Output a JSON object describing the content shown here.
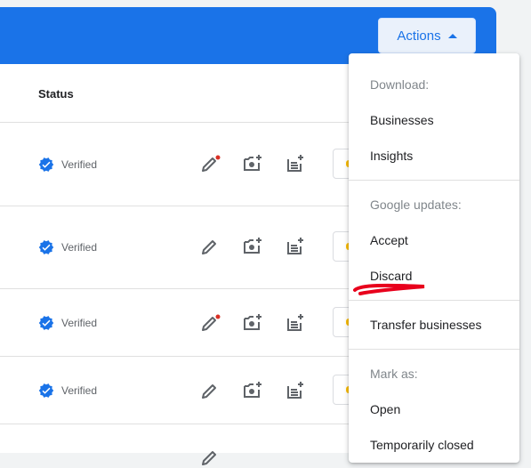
{
  "header": {
    "actions_label": "Actions",
    "accent_color": "#1a73e8"
  },
  "table": {
    "status_header": "Status",
    "rows": [
      {
        "status": "Verified",
        "edit_has_notification": true
      },
      {
        "status": "Verified",
        "edit_has_notification": false
      },
      {
        "status": "Verified",
        "edit_has_notification": true
      },
      {
        "status": "Verified",
        "edit_has_notification": false
      }
    ]
  },
  "menu": {
    "download_label": "Download:",
    "businesses": "Businesses",
    "insights": "Insights",
    "google_updates_label": "Google updates:",
    "accept": "Accept",
    "discard": "Discard",
    "transfer": "Transfer businesses",
    "mark_as_label": "Mark as:",
    "open": "Open",
    "temporarily_closed": "Temporarily closed"
  },
  "icons": {
    "verified": "verified-check-icon",
    "edit": "pencil-icon",
    "add_photo": "add-photo-icon",
    "add_post": "add-post-icon"
  }
}
